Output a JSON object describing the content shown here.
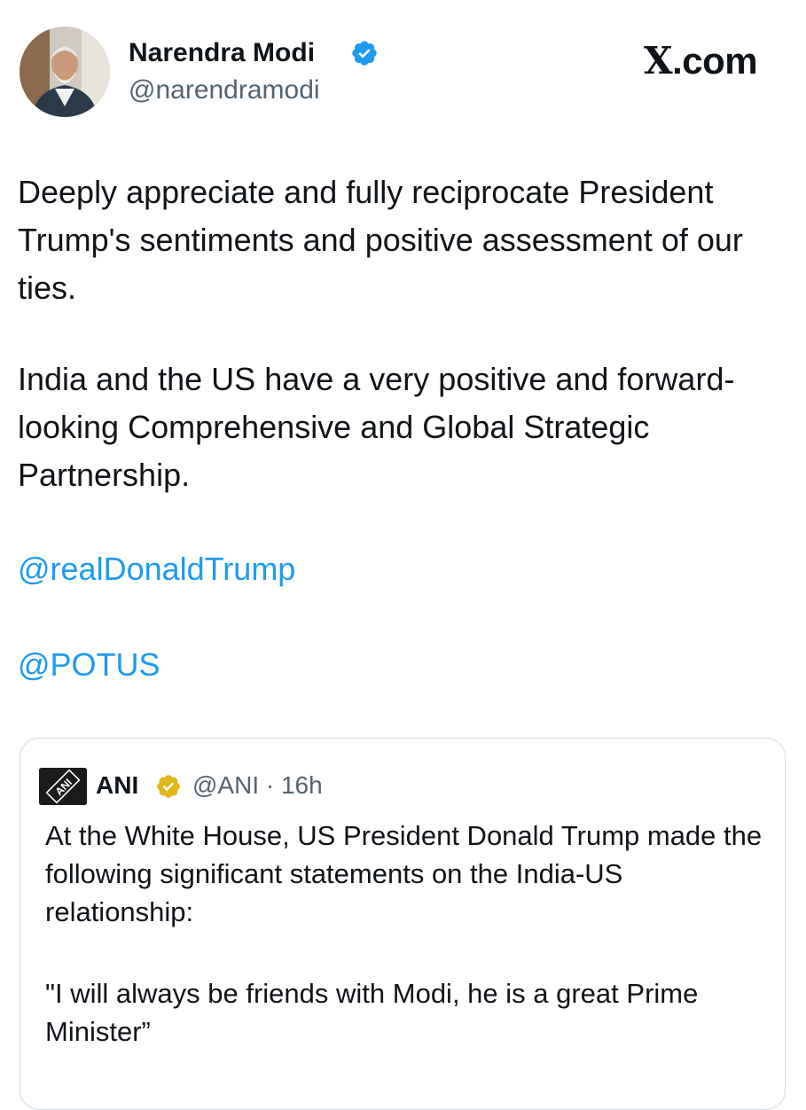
{
  "author": {
    "name": "Narendra Modi",
    "handle": "@narendramodi",
    "verified": "blue-checkmark-icon"
  },
  "brand": {
    "logo_text": ".com",
    "logo_glyph": "X"
  },
  "tweet": {
    "paragraphs": [
      "Deeply appreciate and fully reciprocate President Trump's sentiments and positive assessment of our ties.",
      "India and the US have a very positive and forward-looking Comprehensive and Global Strategic Partnership."
    ],
    "mentions": [
      "@realDonaldTrump",
      "@POTUS"
    ]
  },
  "quoted_tweet": {
    "name": "ANI",
    "handle": "@ANI",
    "separator": "·",
    "time": "16h",
    "handle_time": "@ANI · 16h",
    "logo_text": "ANI",
    "verified": "gold-checkmark-icon",
    "paragraphs": [
      "At the White House, US President Donald Trump made the following significant statements on the India-US relationship:",
      "\"I will always be friends with Modi, he is a great Prime Minister”"
    ]
  },
  "colors": {
    "text": "#0f1419",
    "secondary": "#536471",
    "link": "#1d9bf0",
    "verified_blue": "#1d9bf0",
    "verified_gold": "#e2b719",
    "card_border": "#cfd9de"
  }
}
